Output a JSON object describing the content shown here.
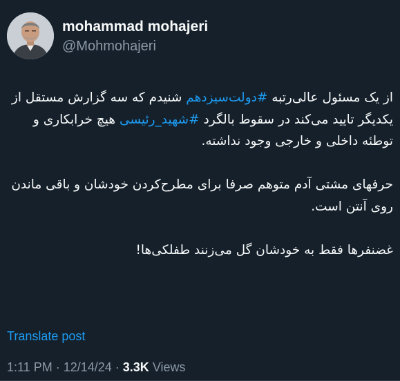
{
  "author": {
    "display_name": "mohammad mohajeri",
    "handle": "@Mohmohajeri",
    "avatar_icon": "profile-photo"
  },
  "tweet": {
    "paragraph1": {
      "part1": "از یک مسئول عالی‌رتبه ",
      "hashtag1": "#دولت‌سیزدهم",
      "part2": " شنیدم که سه گزارش مستقل از یکدیگر تایید می‌کند در سقوط بالگرد ",
      "hashtag2": "#شهید_رئیسی",
      "part3": " هیچ خرابکاری و توطئه داخلی و خارجی وجود نداشته."
    },
    "paragraph2": "حرفهای مشتی آدم متوهم صرفا برای مطرح‌کردن خودشان و باقی ماندن روی آنتن است.",
    "paragraph3": "غضنفرها فقط به خودشان گل می‌زنند طفلکی‌ها!"
  },
  "translate_label": "Translate post",
  "meta": {
    "time": "1:11 PM",
    "separator": " · ",
    "date": "12/14/24",
    "views_count": "3.3K",
    "views_label": " Views"
  },
  "colors": {
    "background": "#15202b",
    "text": "#f7f9f9",
    "secondary": "#8b98a5",
    "link": "#1d9bf0"
  }
}
